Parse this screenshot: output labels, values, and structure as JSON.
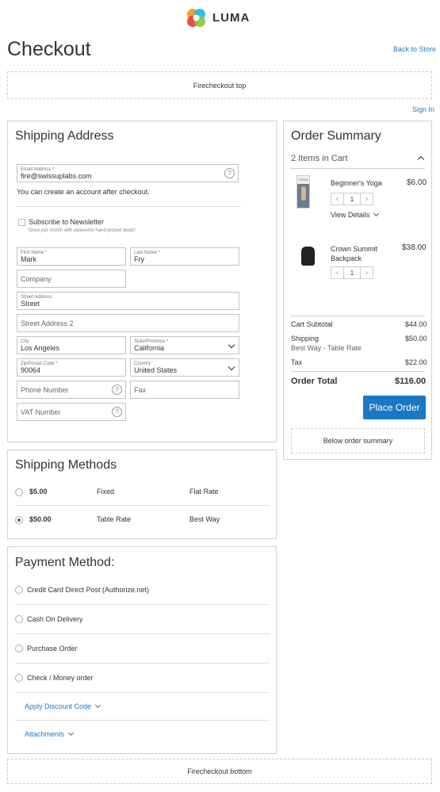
{
  "header": {
    "logo_text": "LUMA",
    "page_title": "Checkout",
    "back_to_store": "Back to Store",
    "firecheckout_top": "Firecheckout top",
    "sign_in": "Sign In"
  },
  "shipping_address": {
    "title": "Shipping Address",
    "email": {
      "label": "Email Address *",
      "value": "fire@swissuplabs.com"
    },
    "account_note": "You can create an account after checkout.",
    "newsletter": {
      "label": "Subscribe to Newsletter",
      "note": "Once per month with awesome hand-picked deals!"
    },
    "first_name": {
      "label": "First Name *",
      "value": "Mark"
    },
    "last_name": {
      "label": "Last Name *",
      "value": "Fry"
    },
    "company": {
      "placeholder": "Company"
    },
    "street": {
      "label": "Street Address",
      "value": "Street"
    },
    "street2": {
      "placeholder": "Street Address 2"
    },
    "city": {
      "label": "City",
      "value": "Los Angeles"
    },
    "region": {
      "label": "State/Province *",
      "value": "California"
    },
    "zip": {
      "label": "Zip/Postal Code *",
      "value": "90064"
    },
    "country": {
      "label": "Country",
      "value": "United States"
    },
    "phone": {
      "placeholder": "Phone Number"
    },
    "fax": {
      "placeholder": "Fax"
    },
    "vat": {
      "placeholder": "VAT Number"
    }
  },
  "shipping_methods": {
    "title": "Shipping Methods",
    "rows": [
      {
        "price": "$5.00",
        "method": "Fixed",
        "carrier": "Flat Rate",
        "selected": false
      },
      {
        "price": "$50.00",
        "method": "Table Rate",
        "carrier": "Best Way",
        "selected": true
      }
    ]
  },
  "payment": {
    "title": "Payment Method:",
    "methods": [
      "Credit Card Direct Post (Authorize.net)",
      "Cash On Delivery",
      "Purchase Order",
      "Check / Money order"
    ],
    "discount": "Apply Discount Code",
    "attachments": "Attachments"
  },
  "order_summary": {
    "title": "Order Summary",
    "items_in_cart": "2 Items in Cart",
    "items": [
      {
        "name": "Beginner's Yoga",
        "price": "$6.00",
        "qty": "1",
        "details": "View Details",
        "thumb_text": "YOGA"
      },
      {
        "name": "Crown Summit Backpack",
        "price": "$38.00",
        "qty": "1"
      }
    ],
    "totals": {
      "subtotal_label": "Cart Subtotal",
      "subtotal": "$44.00",
      "shipping_label": "Shipping",
      "shipping_method": "Best Way - Table Rate",
      "shipping": "$50.00",
      "tax_label": "Tax",
      "tax": "$22.00",
      "order_total_label": "Order Total",
      "order_total": "$116.00"
    },
    "place_order": "Place Order",
    "below_summary": "Below order summary"
  },
  "footer": {
    "firecheckout_bottom": "Firecheckout bottom"
  },
  "colors": {
    "accent": "#1979c3",
    "border": "#d1d1d1"
  }
}
